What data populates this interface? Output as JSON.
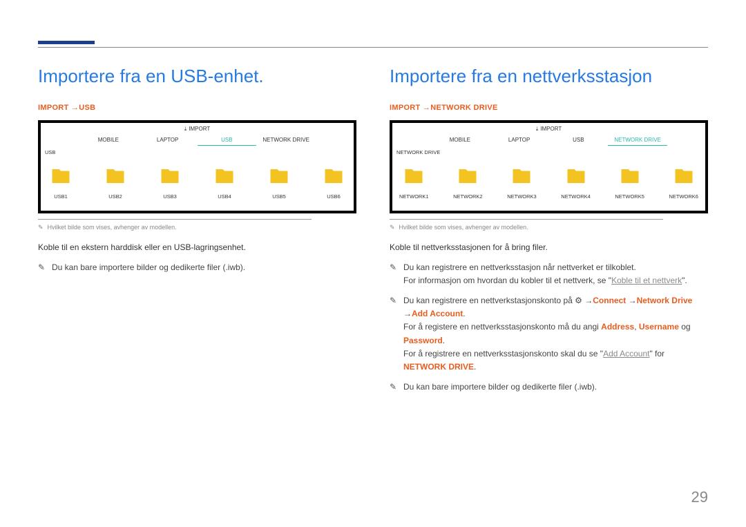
{
  "page_number": "29",
  "usb": {
    "heading": "Importere fra en USB-enhet.",
    "path_import": "IMPORT",
    "path_target": "USB",
    "screen": {
      "title": "IMPORT",
      "tabs": [
        "MOBILE",
        "LAPTOP",
        "USB",
        "NETWORK DRIVE"
      ],
      "active_tab": "USB",
      "crumb": "USB",
      "folders": [
        "USB1",
        "USB2",
        "USB3",
        "USB4",
        "USB5",
        "USB6"
      ]
    },
    "img_note": "Hvilket bilde som vises, avhenger av modellen.",
    "body": "Koble til en ekstern harddisk eller en USB-lagringsenhet.",
    "bullets": {
      "b1": "Du kan bare importere bilder og dedikerte filer (.iwb)."
    }
  },
  "net": {
    "heading": "Importere fra en nettverksstasjon",
    "path_import": "IMPORT",
    "path_target": "NETWORK DRIVE",
    "screen": {
      "title": "IMPORT",
      "tabs": [
        "MOBILE",
        "LAPTOP",
        "USB",
        "NETWORK DRIVE"
      ],
      "active_tab": "NETWORK DRIVE",
      "crumb": "NETWORK DRIVE",
      "folders": [
        "NETWORK1",
        "NETWORK2",
        "NETWORK3",
        "NETWORK4",
        "NETWORK5",
        "NETWORK6"
      ]
    },
    "img_note": "Hvilket bilde som vises, avhenger av modellen.",
    "body": "Koble til nettverksstasjonen for å bring filer.",
    "bullets": {
      "b1_a": "Du kan registrere en nettverksstasjon når nettverket er tilkoblet.",
      "b1_b": "For informasjon om hvordan du kobler til et nettverk, se \"",
      "b1_link": "Koble til et nettverk",
      "b1_c": "\".",
      "b2_a": "Du kan registrere en nettverkstasjonskonto på ",
      "b2_connect": "Connect",
      "b2_nd": "Network Drive",
      "b2_add_acc": "Add Account",
      "b2_period": ".",
      "b2_line2_a": "For å registere en nettverksstasjonskonto må du angi ",
      "b2_address": "Address",
      "b2_comma": ", ",
      "b2_username": "Username",
      "b2_og": " og ",
      "b2_password": "Password",
      "b2_period2": ".",
      "b2_line3_a": "For å registrere en nettverksstasjonskonto skal du se \"",
      "b2_line3_link": "Add Account",
      "b2_line3_b": "\" for ",
      "b2_line3_nd": "NETWORK DRIVE",
      "b2_line3_c": ".",
      "b3": "Du kan bare importere bilder og dedikerte filer (.iwb)."
    }
  }
}
